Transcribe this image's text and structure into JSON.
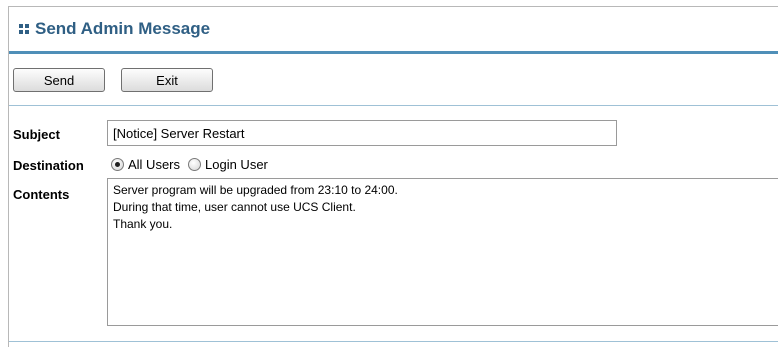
{
  "header": {
    "title": "Send Admin Message",
    "icon": "grid-icon",
    "accent_color": "#2f5f84"
  },
  "toolbar": {
    "send_label": "Send",
    "exit_label": "Exit"
  },
  "form": {
    "subject_label": "Subject",
    "subject_value": "[Notice] Server Restart",
    "destination_label": "Destination",
    "destination_options": [
      {
        "label": "All Users",
        "selected": true
      },
      {
        "label": "Login User",
        "selected": false
      }
    ],
    "contents_label": "Contents",
    "contents_value": "Server program will be upgraded from 23:10 to 24:00.\nDuring that time, user cannot use UCS Client.\nThank you."
  }
}
